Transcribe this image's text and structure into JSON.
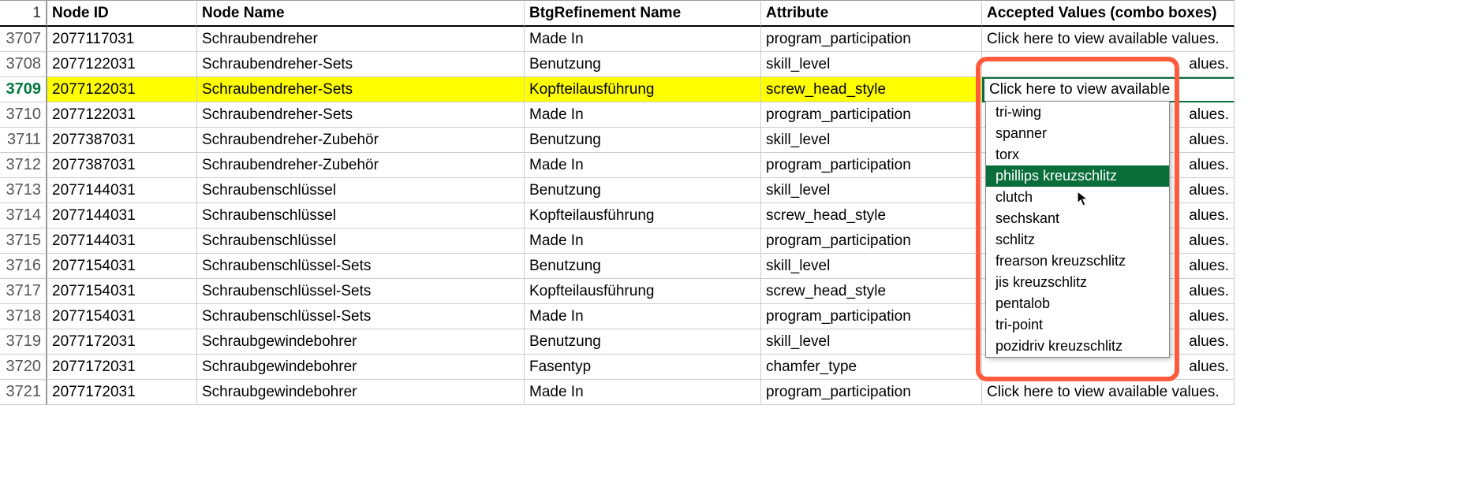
{
  "header_rownum": "1",
  "columns": {
    "node_id": "Node ID",
    "node_name": "Node Name",
    "btg": "BtgRefinement Name",
    "attribute": "Attribute",
    "accepted": "Accepted Values (combo boxes)"
  },
  "accepted_default": "Click here to view available values.",
  "accepted_selected": "Click here to view available",
  "accepted_truncated": "alues.",
  "rows": [
    {
      "rownum": "3707",
      "node_id": "2077117031",
      "node_name": "Schraubendreher",
      "btg": "Made In",
      "attribute": "program_participation"
    },
    {
      "rownum": "3708",
      "node_id": "2077122031",
      "node_name": "Schraubendreher-Sets",
      "btg": "Benutzung",
      "attribute": "skill_level"
    },
    {
      "rownum": "3709",
      "node_id": "2077122031",
      "node_name": "Schraubendreher-Sets",
      "btg": "Kopfteilausführung",
      "attribute": "screw_head_style",
      "selected": true
    },
    {
      "rownum": "3710",
      "node_id": "2077122031",
      "node_name": "Schraubendreher-Sets",
      "btg": "Made In",
      "attribute": "program_participation"
    },
    {
      "rownum": "3711",
      "node_id": "2077387031",
      "node_name": "Schraubendreher-Zubehör",
      "btg": "Benutzung",
      "attribute": "skill_level"
    },
    {
      "rownum": "3712",
      "node_id": "2077387031",
      "node_name": "Schraubendreher-Zubehör",
      "btg": "Made In",
      "attribute": "program_participation"
    },
    {
      "rownum": "3713",
      "node_id": "2077144031",
      "node_name": "Schraubenschlüssel",
      "btg": "Benutzung",
      "attribute": "skill_level"
    },
    {
      "rownum": "3714",
      "node_id": "2077144031",
      "node_name": "Schraubenschlüssel",
      "btg": "Kopfteilausführung",
      "attribute": "screw_head_style"
    },
    {
      "rownum": "3715",
      "node_id": "2077144031",
      "node_name": "Schraubenschlüssel",
      "btg": "Made In",
      "attribute": "program_participation"
    },
    {
      "rownum": "3716",
      "node_id": "2077154031",
      "node_name": "Schraubenschlüssel-Sets",
      "btg": "Benutzung",
      "attribute": "skill_level"
    },
    {
      "rownum": "3717",
      "node_id": "2077154031",
      "node_name": "Schraubenschlüssel-Sets",
      "btg": "Kopfteilausführung",
      "attribute": "screw_head_style"
    },
    {
      "rownum": "3718",
      "node_id": "2077154031",
      "node_name": "Schraubenschlüssel-Sets",
      "btg": "Made In",
      "attribute": "program_participation"
    },
    {
      "rownum": "3719",
      "node_id": "2077172031",
      "node_name": "Schraubgewindebohrer",
      "btg": "Benutzung",
      "attribute": "skill_level"
    },
    {
      "rownum": "3720",
      "node_id": "2077172031",
      "node_name": "Schraubgewindebohrer",
      "btg": "Fasentyp",
      "attribute": "chamfer_type"
    },
    {
      "rownum": "3721",
      "node_id": "2077172031",
      "node_name": "Schraubgewindebohrer",
      "btg": "Made In",
      "attribute": "program_participation"
    }
  ],
  "dropdown": {
    "options": [
      "tri-wing",
      "spanner",
      "torx",
      "phillips kreuzschlitz",
      "clutch",
      "sechskant",
      "schlitz",
      "frearson kreuzschlitz",
      "jis kreuzschlitz",
      "pentalob",
      "tri-point",
      "pozidriv kreuzschlitz"
    ],
    "selected_index": 3
  }
}
